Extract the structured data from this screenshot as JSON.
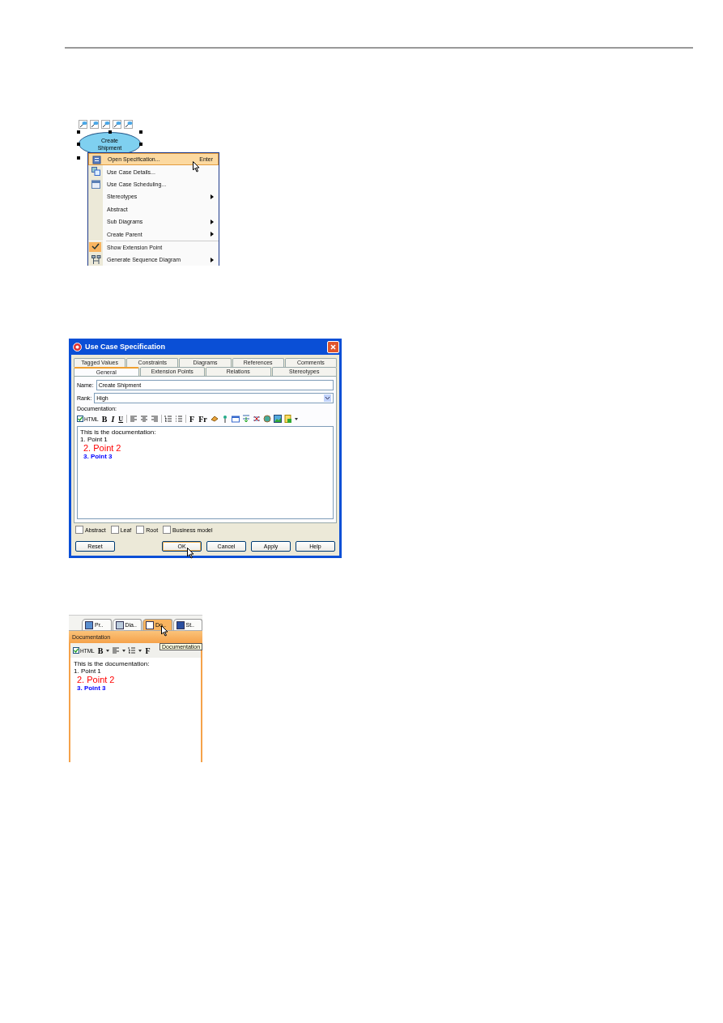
{
  "figure_1": {
    "diagram": {
      "use_case": "Create Shipment"
    },
    "context_menu": [
      {
        "label": "Open Specification...",
        "shortcut": "Enter",
        "kind": "command",
        "selected": true
      },
      {
        "label": "Use Case Details...",
        "kind": "command",
        "selected": false
      },
      {
        "label": "Use Case Scheduling...",
        "kind": "command",
        "selected": false
      },
      {
        "label": "Stereotypes",
        "kind": "submenu",
        "selected": false
      },
      {
        "label": "Abstract",
        "kind": "command",
        "selected": false
      },
      {
        "label": "Sub Diagrams",
        "kind": "submenu",
        "selected": false
      },
      {
        "label": "Create Parent",
        "kind": "submenu",
        "selected": false
      },
      {
        "label": "Show Extension Point",
        "kind": "check",
        "checked": true,
        "selected": false
      },
      {
        "label": "Generate Sequence Diagram",
        "kind": "submenu",
        "selected": false
      }
    ]
  },
  "figure_2": {
    "window": {
      "title": "Use Case Specification"
    },
    "tabs_back": [
      {
        "label": "Tagged Values",
        "selected": false
      },
      {
        "label": "Constraints",
        "selected": false
      },
      {
        "label": "Diagrams",
        "selected": false
      },
      {
        "label": "References",
        "selected": false
      },
      {
        "label": "Comments",
        "selected": false
      }
    ],
    "tabs_front": [
      {
        "label": "General",
        "selected": true
      },
      {
        "label": "Extension Points",
        "selected": false
      },
      {
        "label": "Relations",
        "selected": false
      },
      {
        "label": "Stereotypes",
        "selected": false
      }
    ],
    "name": {
      "label": "Name:",
      "value": "Create Shipment"
    },
    "rank": {
      "label": "Rank:",
      "value": "High"
    },
    "documentation": {
      "label": "Documentation:",
      "html": {
        "label": "HTML",
        "checked": true
      },
      "format_buttons": [
        "B",
        "I",
        "U"
      ],
      "font_buttons": [
        "F",
        "Fr"
      ],
      "lines": [
        {
          "text": "This is the documentation:",
          "kind": "plain"
        },
        {
          "text": "1. Point 1",
          "kind": "plain"
        },
        {
          "text": "2. Point 2",
          "kind": "red"
        },
        {
          "text": "3. Point 3",
          "kind": "blue"
        }
      ]
    },
    "checkboxes": [
      {
        "label": "Abstract",
        "checked": false
      },
      {
        "label": "Leaf",
        "checked": false
      },
      {
        "label": "Root",
        "checked": false
      },
      {
        "label": "Business model",
        "checked": false
      }
    ],
    "buttons": [
      {
        "label": "Reset",
        "default": false
      },
      {
        "label": "OK",
        "default": true
      },
      {
        "label": "Cancel",
        "default": false
      },
      {
        "label": "Apply",
        "default": false
      },
      {
        "label": "Help",
        "default": false
      }
    ]
  },
  "figure_3": {
    "tabs": [
      {
        "label": "Pr..",
        "selected": false
      },
      {
        "label": "Dia..",
        "selected": false
      },
      {
        "label": "Do..",
        "selected": true
      },
      {
        "label": "St..",
        "selected": false
      }
    ],
    "tooltip": "Documentation",
    "panel": {
      "title": "Documentation",
      "html": {
        "label": "HTML",
        "checked": true
      },
      "format_buttons": [
        "B"
      ],
      "font_buttons": [
        "F"
      ],
      "lines": [
        {
          "text": "This is the documentation:",
          "kind": "plain"
        },
        {
          "text": "1. Point 1",
          "kind": "plain"
        },
        {
          "text": "2. Point 2",
          "kind": "red"
        },
        {
          "text": "3. Point 3",
          "kind": "blue"
        }
      ]
    }
  }
}
